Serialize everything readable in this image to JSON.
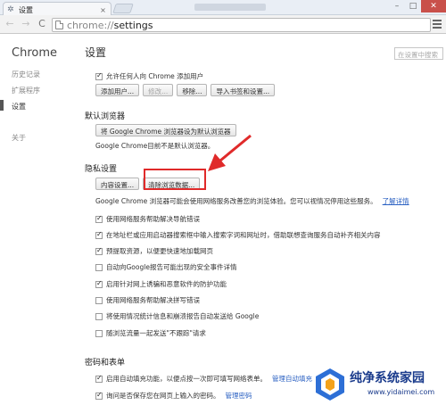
{
  "browser": {
    "tab_title": "设置",
    "tab_icon": "gear-icon",
    "tab_close": "×",
    "url_scheme": "chrome://",
    "url_path": "settings",
    "win_min": "–",
    "win_max": "□",
    "win_close": "✕",
    "back": "←",
    "forward": "→",
    "reload": "C"
  },
  "sidebar": {
    "title": "Chrome",
    "items": [
      {
        "label": "历史记录"
      },
      {
        "label": "扩展程序"
      },
      {
        "label": "设置"
      },
      {
        "label": "关于"
      }
    ]
  },
  "main": {
    "title": "设置",
    "search_placeholder": "在设置中搜索",
    "users": {
      "allow_add_label": "允许任何人向 Chrome 添加用户",
      "allow_add_checked": true,
      "buttons": {
        "add": "添加用户...",
        "edit": "修改...",
        "remove": "移除...",
        "import": "导入书签和设置..."
      }
    },
    "default_browser": {
      "title": "默认浏览器",
      "button": "将 Google Chrome 浏览器设为默认浏览器",
      "status": "Google Chrome目前不是默认浏览器。"
    },
    "privacy": {
      "title": "隐私设置",
      "content_button": "内容设置...",
      "clear_button": "清除浏览数据...",
      "description": "Google Chrome 浏览器可能会使用网络服务改善您的浏览体验。您可以视情况停用这些服务。",
      "learn_more": "了解详情",
      "options": [
        {
          "label": "使用网络服务帮助解决导航错误",
          "checked": true
        },
        {
          "label": "在地址栏或应用启动器搜索框中输入搜索字词和网址时，借助联想查询服务自动补齐相关内容",
          "checked": true
        },
        {
          "label": "预提取资源，以便更快速地加载网页",
          "checked": true
        },
        {
          "label": "自动向Google报告可能出现的安全事件详情",
          "checked": false
        },
        {
          "label": "启用针对网上诱骗和恶意软件的防护功能",
          "checked": true
        },
        {
          "label": "使用网络服务帮助解决拼写错误",
          "checked": false
        },
        {
          "label": "将使用情况统计信息和崩溃报告自动发送给 Google",
          "checked": false
        },
        {
          "label": "随浏览流量一起发送\"不跟踪\"请求",
          "checked": false
        }
      ]
    },
    "passwords": {
      "title": "密码和表单",
      "autofill_label": "启用自动填充功能，以便点按一次即可填写网络表单。",
      "autofill_link": "管理自动填充",
      "autofill_checked": true,
      "save_pw_label": "询问是否保存您在网页上输入的密码。",
      "save_pw_link": "管理密码",
      "save_pw_checked": true
    }
  },
  "watermark": {
    "title": "纯净系统家园",
    "url": "www.yidaimei.com"
  },
  "colors": {
    "annotation": "#e02a2a",
    "link": "#2a60c2",
    "watermark": "#1a3b8c"
  }
}
